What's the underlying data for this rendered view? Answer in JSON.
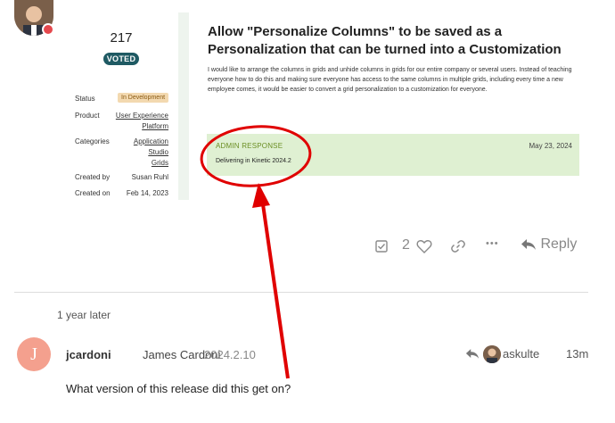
{
  "topic": {
    "vote_count": "217",
    "voted_label": "VOTED",
    "title": "Allow \"Personalize Columns\" to be saved as a Personalization that can be turned into a Customization",
    "body": "I would like to arrange the columns in grids and unhide columns in grids for our entire company or several users. Instead of teaching everyone how to do this and making sure everyone has access to the same columns in multiple grids, including every time a new employee comes, it would be easier to convert a grid personalization to a customization for everyone."
  },
  "meta": {
    "status_label": "Status",
    "status_value": "In Development",
    "product_label": "Product",
    "product_value_1": "User Experience",
    "product_value_2": "Platform",
    "categories_label": "Categories",
    "categories_value_1": "Application",
    "categories_value_2": "Studio",
    "categories_value_3": "Grids",
    "created_by_label": "Created by",
    "created_by_value": "Susan Ruhl",
    "created_on_label": "Created on",
    "created_on_value": "Feb 14, 2023"
  },
  "admin_response": {
    "title": "ADMIN RESPONSE",
    "date": "May 23, 2024",
    "text": "Delivering in Kinetic 2024.2"
  },
  "actions": {
    "like_count": "2",
    "more": "•••",
    "reply_label": "Reply"
  },
  "time_gap": "1 year later",
  "reply": {
    "avatar_letter": "J",
    "username": "jcardoni",
    "full_name": "James Cardoni",
    "flair": "2024.2.10",
    "reply_to": "askulte",
    "time": "13m",
    "text": "What version of this release did this get on?"
  },
  "colors": {
    "voted_badge": "#1f5a63",
    "status_badge_bg": "#f3d9b0",
    "admin_box_bg": "#dff0d2",
    "admin_title": "#6b8e23",
    "reply_avatar": "#f4a08e",
    "annotation_red": "#e00000"
  }
}
